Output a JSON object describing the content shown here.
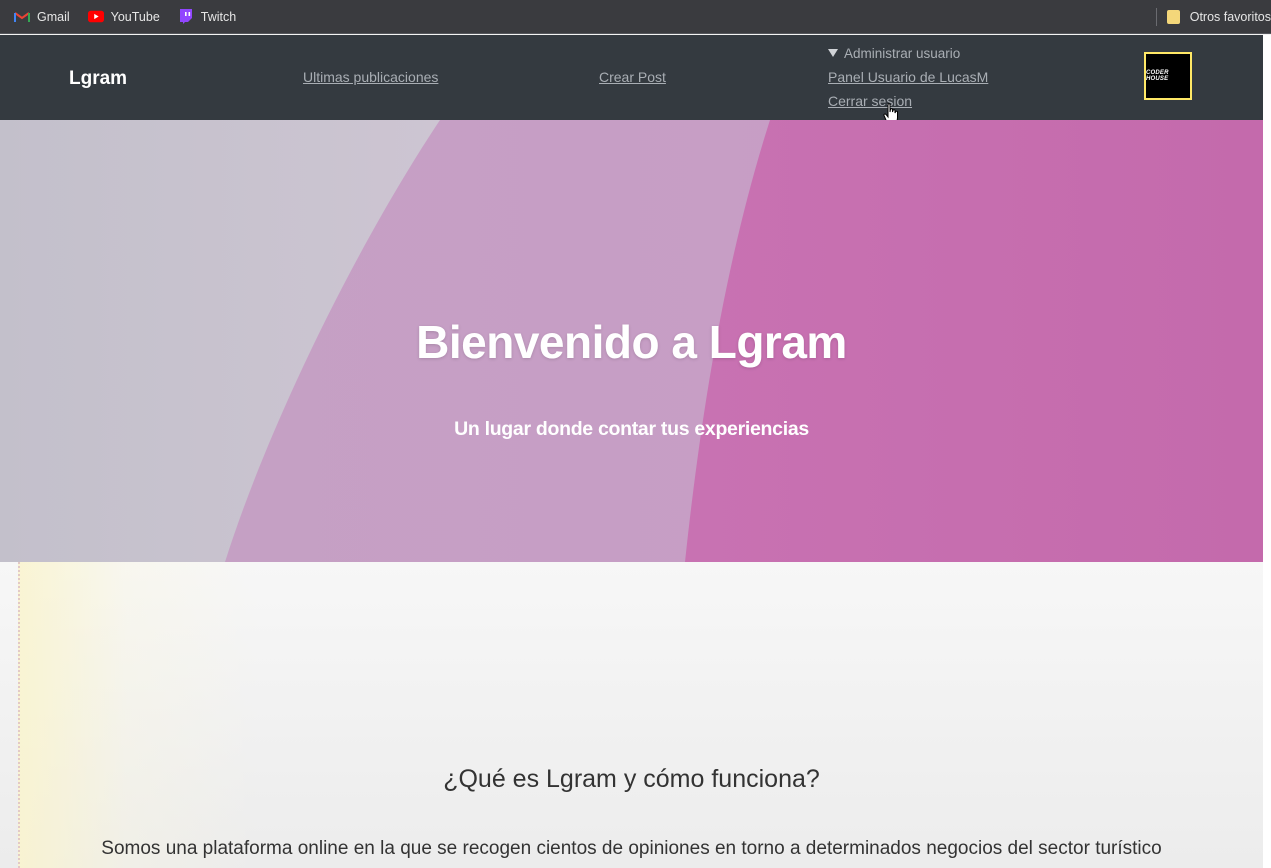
{
  "bookmarks": {
    "items": [
      {
        "label": "Gmail",
        "icon": "gmail-icon"
      },
      {
        "label": "YouTube",
        "icon": "youtube-icon"
      },
      {
        "label": "Twitch",
        "icon": "twitch-icon"
      }
    ],
    "other_folder": "Otros favoritos"
  },
  "nav": {
    "brand": "Lgram",
    "links": {
      "latest": "Ultimas publicaciones",
      "create": "Crear Post"
    },
    "user_menu": {
      "summary": "Administrar usuario",
      "panel": "Panel Usuario de LucasM",
      "logout": "Cerrar sesion"
    },
    "logo_text": "CODER HOUSE"
  },
  "hero": {
    "title": "Bienvenido a Lgram",
    "subtitle": "Un lugar donde contar tus experiencias"
  },
  "content": {
    "heading": "¿Qué es Lgram y cómo funciona?",
    "paragraph": "Somos una plataforma online en la que se recogen cientos de opiniones en torno a determinados negocios del sector turístico"
  },
  "colors": {
    "nav_bg": "#343a40",
    "hero_pink": "#c96fb0",
    "hero_lilac": "#c7a2c8",
    "hero_grey": "#c5c1d0"
  }
}
